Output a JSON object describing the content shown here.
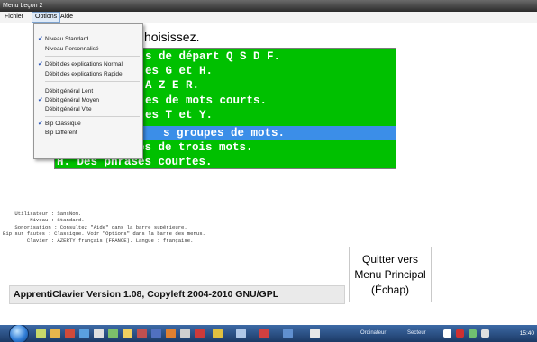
{
  "window": {
    "title": "Menu Leçon 2"
  },
  "menubar": {
    "items": [
      "Fichier",
      "Options",
      "Aide"
    ],
    "open": "Options"
  },
  "options_menu": {
    "items": [
      {
        "label": "Niveau Standard",
        "checked": true
      },
      {
        "label": "Niveau Personnalisé",
        "checked": false
      },
      {
        "label": "Débit des explications Normal",
        "checked": true
      },
      {
        "label": "Débit des explications Rapide",
        "checked": false
      },
      {
        "label": "Débit général Lent",
        "checked": false
      },
      {
        "label": "Débit général Moyen",
        "checked": true
      },
      {
        "label": "Débit général Vite",
        "checked": false
      },
      {
        "label": "Bip Classique",
        "checked": true
      },
      {
        "label": "Bip Différent",
        "checked": false
      }
    ]
  },
  "heading": "hoisissez.",
  "lesson_list": {
    "items": [
      {
        "text": "s de départ Q S D F.",
        "selected": false
      },
      {
        "text": "es G et H.",
        "selected": false
      },
      {
        "text": "A Z E R.",
        "selected": false
      },
      {
        "text": "es de mots courts.",
        "selected": false
      },
      {
        "text": "es T et Y.",
        "selected": false
      },
      {
        "text": "s groupes de mots.",
        "selected": true
      },
      {
        "text": "G. Des groupes de trois mots.",
        "selected": false
      },
      {
        "text": "H. Des phrases courtes.",
        "selected": false
      }
    ]
  },
  "info": {
    "lines": [
      "    Utilisateur : SansNom.",
      "         Niveau : Standard.",
      "    Sonorisation : Consultez \"Aide\" dans la barre supérieure.",
      "Bip sur fautes : Classique. Voir \"Options\" dans la barre des menus.",
      "        Clavier : AZERTY français (FRANCE). Langue : française."
    ]
  },
  "quit_button": {
    "line1": "Quitter vers",
    "line2": "Menu Principal",
    "line3": "(Échap)"
  },
  "version": "ApprentiClavier Version 1.08,   Copyleft 2004-2010 GNU/GPL",
  "taskbar": {
    "ordinateur": "Ordinateur",
    "secteur": "Secteur",
    "clock": "15:40"
  },
  "colors": {
    "list_bg": "#00c000",
    "selected": "#3b8ee8",
    "check": "#2a55b8"
  }
}
